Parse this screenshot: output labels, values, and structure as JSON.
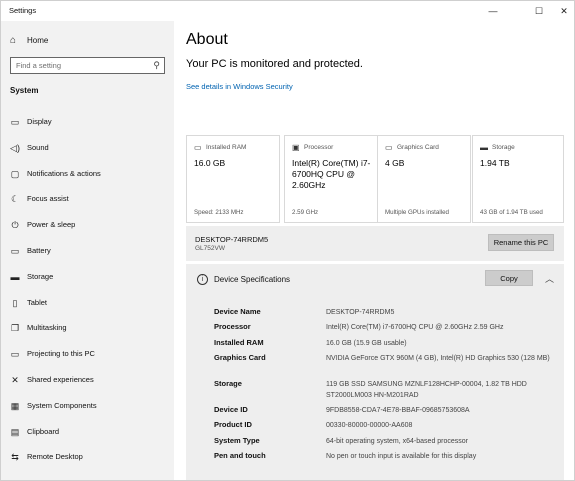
{
  "window": {
    "title": "Settings",
    "controls": {
      "minimize": "—",
      "maximize": "☐",
      "close": "✕"
    }
  },
  "sidebar": {
    "home_label": "Home",
    "search_placeholder": "Find a setting",
    "section": "System",
    "items": [
      {
        "label": "Display",
        "icon": "display-icon"
      },
      {
        "label": "Sound",
        "icon": "speaker-icon"
      },
      {
        "label": "Notifications & actions",
        "icon": "notification-icon"
      },
      {
        "label": "Focus assist",
        "icon": "moon-icon"
      },
      {
        "label": "Power & sleep",
        "icon": "power-icon"
      },
      {
        "label": "Battery",
        "icon": "battery-icon"
      },
      {
        "label": "Storage",
        "icon": "storage-icon"
      },
      {
        "label": "Tablet",
        "icon": "tablet-icon"
      },
      {
        "label": "Multitasking",
        "icon": "multitasking-icon"
      },
      {
        "label": "Projecting to this PC",
        "icon": "projecting-icon"
      },
      {
        "label": "Shared experiences",
        "icon": "shared-icon"
      },
      {
        "label": "System Components",
        "icon": "components-icon"
      },
      {
        "label": "Clipboard",
        "icon": "clipboard-icon"
      },
      {
        "label": "Remote Desktop",
        "icon": "remote-desktop-icon"
      }
    ]
  },
  "main": {
    "title": "About",
    "status": "Your PC is monitored and protected.",
    "security_link": "See details in Windows Security",
    "cards": [
      {
        "label": "Installed RAM",
        "value": "16.0 GB",
        "sub": "Speed: 2133 MHz",
        "icon": "ram-icon"
      },
      {
        "label": "Processor",
        "value": "Intel(R) Core(TM) i7-6700HQ CPU @ 2.60GHz",
        "sub": "2.59 GHz",
        "icon": "processor-icon"
      },
      {
        "label": "Graphics Card",
        "value": "4 GB",
        "sub": "Multiple GPUs installed",
        "icon": "graphics-card-icon"
      },
      {
        "label": "Storage",
        "value": "1.94 TB",
        "sub": "43 GB of 1.94 TB used",
        "icon": "storage-icon"
      }
    ],
    "device": {
      "name": "DESKTOP-74RRDM5",
      "model": "GL752VW",
      "rename_button": "Rename this PC"
    },
    "specs": {
      "heading": "Device Specifications",
      "copy_button": "Copy",
      "rows": [
        {
          "key": "Device Name",
          "value": "DESKTOP-74RRDM5"
        },
        {
          "key": "Processor",
          "value": "Intel(R) Core(TM) i7-6700HQ CPU @ 2.60GHz   2.59 GHz"
        },
        {
          "key": "Installed RAM",
          "value": "16.0 GB (15.9 GB usable)"
        },
        {
          "key": "Graphics Card",
          "value": "NVIDIA GeForce GTX 960M (4 GB), Intel(R) HD Graphics 530 (128 MB)"
        },
        {
          "key": "Storage",
          "value": "119 GB SSD SAMSUNG MZNLF128HCHP-00004, 1.82 TB HDD ST2000LM003 HN-M201RAD"
        },
        {
          "key": "Device ID",
          "value": "9FDB8558-CDA7-4E78-BBAF-09685753608A"
        },
        {
          "key": "Product ID",
          "value": "00330-80000-00000-AA608"
        },
        {
          "key": "System Type",
          "value": "64-bit operating system, x64-based processor"
        },
        {
          "key": "Pen and touch",
          "value": "No pen or touch input is available for this display"
        }
      ]
    }
  }
}
